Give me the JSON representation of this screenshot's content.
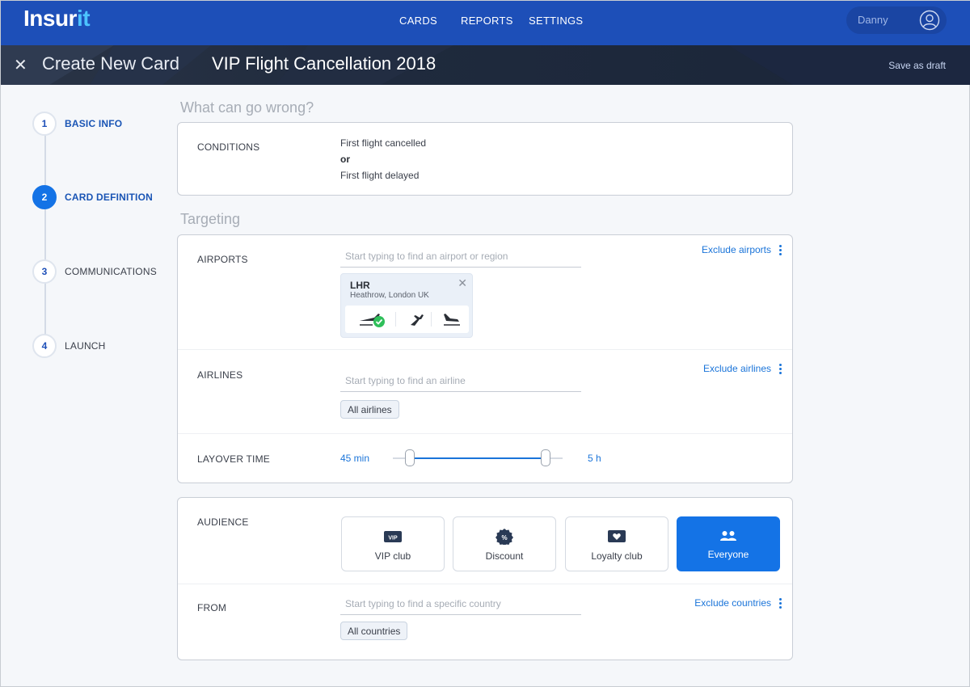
{
  "app": {
    "logo_main": "Insur",
    "logo_accent": "it"
  },
  "nav": {
    "items": [
      "CARDS",
      "REPORTS",
      "SETTINGS"
    ]
  },
  "user": {
    "name": "Danny"
  },
  "header": {
    "section": "Create New Card",
    "card_name": "VIP Flight Cancellation 2018",
    "save_draft": "Save as draft"
  },
  "steps": [
    {
      "number": "1",
      "label": "BASIC INFO",
      "state": "done"
    },
    {
      "number": "2",
      "label": "CARD DEFINITION",
      "state": "active"
    },
    {
      "number": "3",
      "label": "COMMUNICATIONS",
      "state": "pending"
    },
    {
      "number": "4",
      "label": "LAUNCH",
      "state": "pending"
    }
  ],
  "what_can_go_wrong": {
    "title": "What can go wrong?",
    "conditions_label": "CONDITIONS",
    "condition_1": "First flight cancelled",
    "or_label": "or",
    "condition_2": "First flight delayed"
  },
  "targeting": {
    "title": "Targeting",
    "airports": {
      "label": "AIRPORTS",
      "placeholder": "Start typing to find an airport or region",
      "exclude_link": "Exclude airports",
      "selected": {
        "code": "LHR",
        "name": "Heathrow, London UK"
      }
    },
    "airlines": {
      "label": "AIRLINES",
      "placeholder": "Start typing to find an airline",
      "exclude_link": "Exclude airlines",
      "chip": "All airlines"
    },
    "layover": {
      "label": "LAYOVER TIME",
      "min_label": "45 min",
      "max_label": "5 h",
      "range_low_fraction": 0.1,
      "range_high_fraction": 0.9
    }
  },
  "audience": {
    "label": "AUDIENCE",
    "options": [
      {
        "label": "VIP club",
        "icon": "vip-badge-icon",
        "selected": false
      },
      {
        "label": "Discount",
        "icon": "discount-icon",
        "selected": false
      },
      {
        "label": "Loyalty club",
        "icon": "heart-card-icon",
        "selected": false
      },
      {
        "label": "Everyone",
        "icon": "people-icon",
        "selected": true
      }
    ],
    "from": {
      "label": "FROM",
      "placeholder": "Start typing to find a specific country",
      "exclude_link": "Exclude countries",
      "chip": "All countries"
    }
  },
  "colors": {
    "brand": "#1d4fb8",
    "accent": "#1473e6",
    "link": "#1a74d9"
  }
}
